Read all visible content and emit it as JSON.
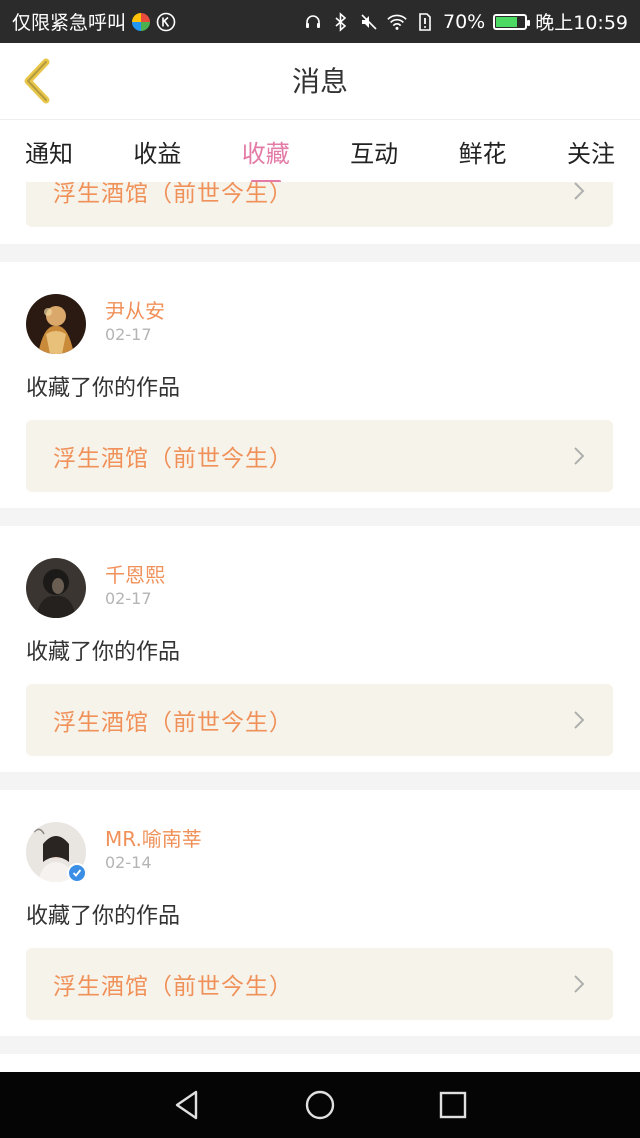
{
  "status_bar": {
    "carrier": "仅限紧急呼叫",
    "battery_percent": "70%",
    "battery_level": 0.7,
    "time": "晚上10:59"
  },
  "header": {
    "title": "消息"
  },
  "tabs": [
    {
      "label": "通知",
      "active": false
    },
    {
      "label": "收益",
      "active": false
    },
    {
      "label": "收藏",
      "active": true
    },
    {
      "label": "互动",
      "active": false
    },
    {
      "label": "鲜花",
      "active": false
    },
    {
      "label": "关注",
      "active": false
    }
  ],
  "partial_item": {
    "work_title": "浮生酒馆（前世今生）"
  },
  "items": [
    {
      "username": "尹从安",
      "date": "02-17",
      "action": "收藏了你的作品",
      "work_title": "浮生酒馆（前世今生）",
      "verified": false
    },
    {
      "username": "千恩熙",
      "date": "02-17",
      "action": "收藏了你的作品",
      "work_title": "浮生酒馆（前世今生）",
      "verified": false
    },
    {
      "username": "MR.喻南莘",
      "date": "02-14",
      "action": "收藏了你的作品",
      "work_title": "浮生酒馆（前世今生）",
      "verified": true
    }
  ],
  "colors": {
    "accent": "#e37ba6",
    "username": "#f0915a",
    "work_bg": "#f6f3ea"
  }
}
